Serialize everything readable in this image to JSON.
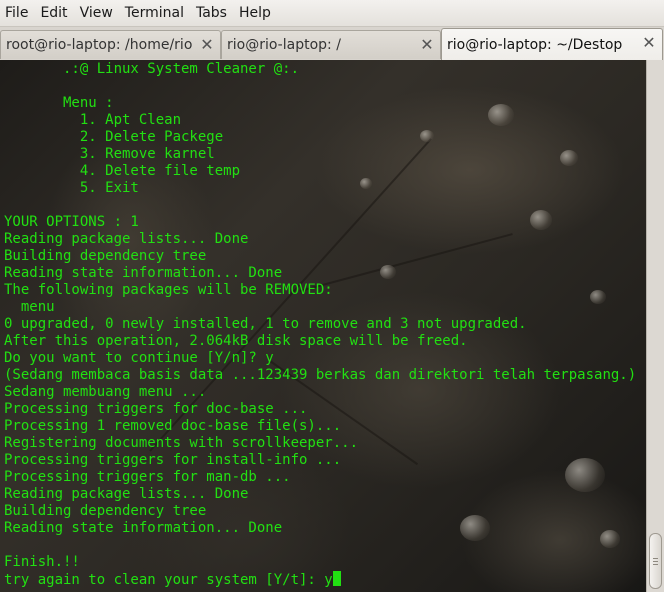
{
  "menubar": {
    "items": [
      "File",
      "Edit",
      "View",
      "Terminal",
      "Tabs",
      "Help"
    ]
  },
  "tabs": [
    {
      "label": "root@rio-laptop: /home/rio",
      "active": false
    },
    {
      "label": "rio@rio-laptop: /",
      "active": false
    },
    {
      "label": "rio@rio-laptop: ~/Destop",
      "active": true
    }
  ],
  "terminal": {
    "text_color": "#22e012",
    "lines": [
      "       .:@ Linux System Cleaner @:.",
      "",
      "       Menu :",
      "         1. Apt Clean",
      "         2. Delete Packege",
      "         3. Remove karnel",
      "         4. Delete file temp",
      "         5. Exit",
      "",
      "YOUR OPTIONS : 1",
      "Reading package lists... Done",
      "Building dependency tree",
      "Reading state information... Done",
      "The following packages will be REMOVED:",
      "  menu",
      "0 upgraded, 0 newly installed, 1 to remove and 3 not upgraded.",
      "After this operation, 2.064kB disk space will be freed.",
      "Do you want to continue [Y/n]? y",
      "(Sedang membaca basis data ...123439 berkas dan direktori telah terpasang.)",
      "Sedang membuang menu ...",
      "Processing triggers for doc-base ...",
      "Processing 1 removed doc-base file(s)...",
      "Registering documents with scrollkeeper...",
      "Processing triggers for install-info ...",
      "Processing triggers for man-db ...",
      "Reading package lists... Done",
      "Building dependency tree",
      "Reading state information... Done",
      "",
      "Finish.!!"
    ],
    "prompt_line": "try again to clean your system [Y/t]: y"
  },
  "icons": {
    "tab_close": "close-icon"
  }
}
